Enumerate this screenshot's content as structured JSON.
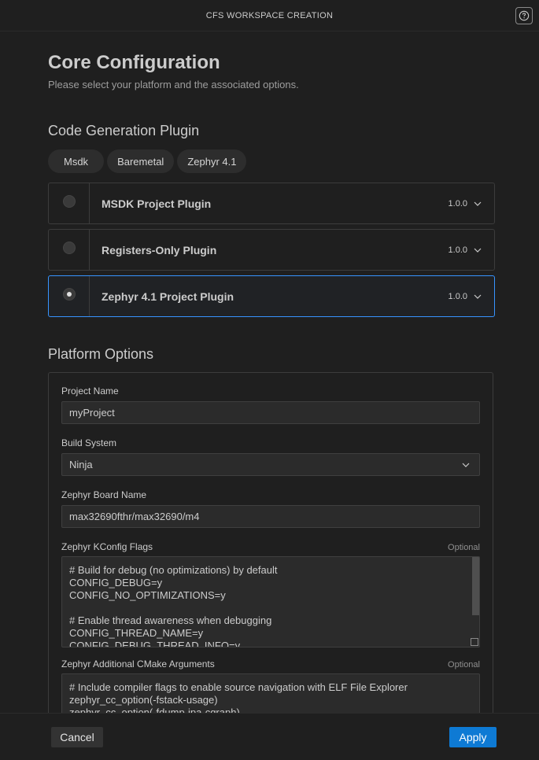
{
  "window": {
    "title": "CFS WORKSPACE CREATION"
  },
  "page": {
    "title": "Core Configuration",
    "subtitle": "Please select your platform and the associated options."
  },
  "code_generation": {
    "title": "Code Generation Plugin",
    "chips": [
      {
        "label": "Msdk"
      },
      {
        "label": "Baremetal"
      },
      {
        "label": "Zephyr 4.1"
      }
    ],
    "plugins": [
      {
        "name": "MSDK Project Plugin",
        "version": "1.0.0",
        "selected": false
      },
      {
        "name": "Registers-Only Plugin",
        "version": "1.0.0",
        "selected": false
      },
      {
        "name": "Zephyr 4.1 Project Plugin",
        "version": "1.0.0",
        "selected": true
      }
    ]
  },
  "platform_options": {
    "title": "Platform Options",
    "project_name": {
      "label": "Project Name",
      "value": "myProject"
    },
    "build_system": {
      "label": "Build System",
      "value": "Ninja"
    },
    "board_name": {
      "label": "Zephyr Board Name",
      "value": "max32690fthr/max32690/m4"
    },
    "kconfig": {
      "label": "Zephyr KConfig Flags",
      "optional": "Optional",
      "lines": [
        "# Build for debug (no optimizations) by default",
        "CONFIG_DEBUG=y",
        "CONFIG_NO_OPTIMIZATIONS=y",
        "",
        "# Enable thread awareness when debugging",
        "CONFIG_THREAD_NAME=y",
        "CONFIG_DEBUG_THREAD_INFO=y"
      ]
    },
    "cmake": {
      "label": "Zephyr Additional CMake Arguments",
      "optional": "Optional",
      "lines": [
        "# Include compiler flags to enable source navigation with ELF File Explorer",
        "zephyr_cc_option(-fstack-usage)",
        "zephyr_cc_option(-fdump-ipa-cgraph)"
      ]
    }
  },
  "footer": {
    "cancel_label": "Cancel",
    "apply_label": "Apply"
  },
  "colors": {
    "accent": "#3794ff",
    "primary_button": "#0e7ad4",
    "background": "#1f1f1f"
  }
}
